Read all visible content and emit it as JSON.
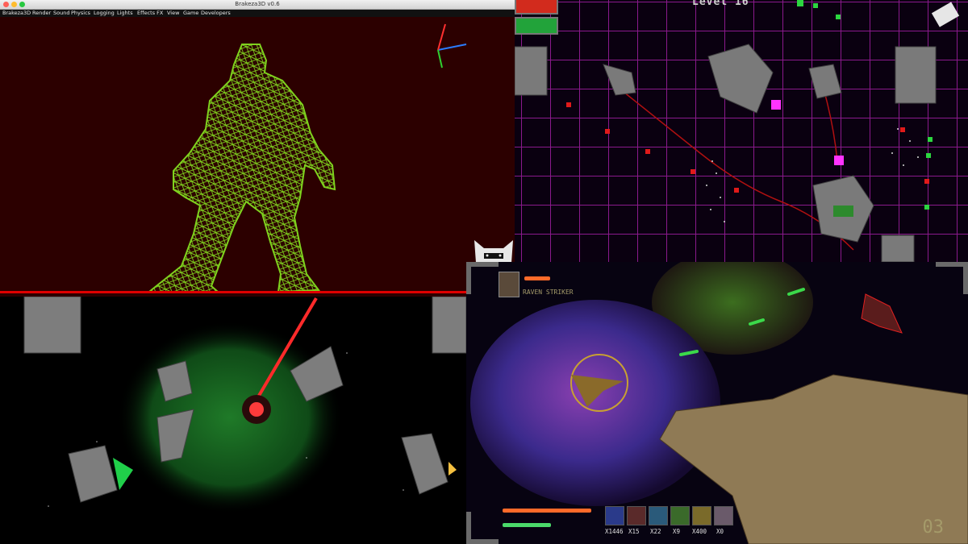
{
  "editor": {
    "window_title": "Brakeza3D v0.6",
    "menu": [
      "Brakeza3D",
      "Render",
      "Sound",
      "Physics",
      "Logging",
      "Lights",
      "Effects FX",
      "View",
      "Game",
      "Developers"
    ],
    "wireframe_color": "#7fd21e",
    "background_color": "#2c0000"
  },
  "arena": {
    "level_label": "Level 16",
    "grid_color": "#8a1a8c",
    "health_color": "#d22b1d",
    "energy_color": "#22a33a"
  },
  "cockpit": {
    "pilot_name": "RAVEN STRIKER",
    "inventory": [
      {
        "icon": "blue-orb-icon",
        "count": "X1446"
      },
      {
        "icon": "burst-icon",
        "count": "X15"
      },
      {
        "icon": "shield-icon",
        "count": "X22"
      },
      {
        "icon": "missile-icon",
        "count": "X9"
      },
      {
        "icon": "coin-icon",
        "count": "X400"
      },
      {
        "icon": "pilot-icon",
        "count": "X0"
      }
    ],
    "score": "03"
  }
}
